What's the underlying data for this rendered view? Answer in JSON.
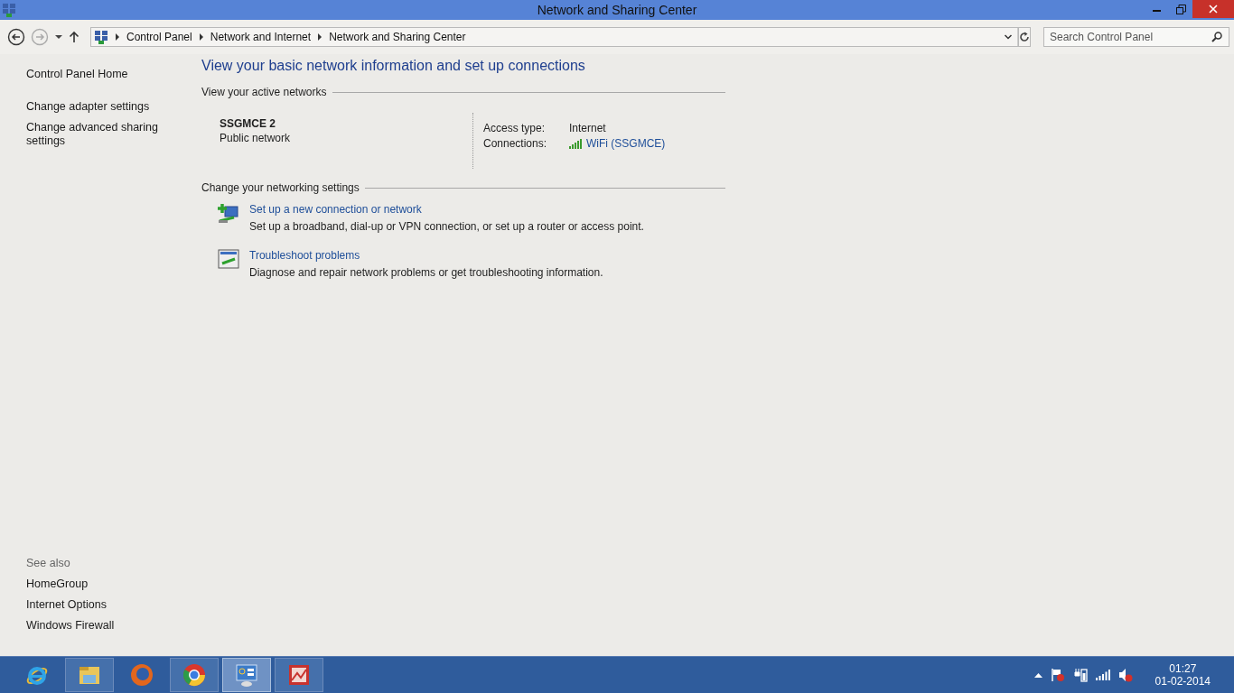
{
  "window": {
    "title": "Network and Sharing Center"
  },
  "address_bar": {
    "breadcrumb": [
      "Control Panel",
      "Network and Internet",
      "Network and Sharing Center"
    ],
    "search": {
      "placeholder": "Search Control Panel"
    }
  },
  "sidebar": {
    "links": [
      "Control Panel Home",
      "Change adapter settings",
      "Change advanced sharing settings"
    ],
    "see_also": {
      "heading": "See also",
      "links": [
        "HomeGroup",
        "Internet Options",
        "Windows Firewall"
      ]
    }
  },
  "main": {
    "heading": "View your basic network information and set up connections",
    "active_networks": {
      "heading": "View your active networks",
      "name": "SSGMCE  2",
      "type": "Public network",
      "access_type_label": "Access type:",
      "access_type": "Internet",
      "connections_label": "Connections:",
      "connection": "WiFi (SSGMCE)"
    },
    "settings": {
      "heading": "Change your networking settings",
      "tasks": [
        {
          "kind": "new-connection",
          "title": "Set up a new connection or network",
          "description": "Set up a broadband, dial-up or VPN connection, or set up a router or access point."
        },
        {
          "kind": "troubleshoot",
          "title": "Troubleshoot problems",
          "description": "Diagnose and repair network problems or get troubleshooting information."
        }
      ]
    }
  },
  "taskbar": {
    "apps": [
      {
        "kind": "ie",
        "running": false,
        "selected": false
      },
      {
        "kind": "explorer",
        "running": true,
        "selected": false
      },
      {
        "kind": "firefox",
        "running": false,
        "selected": false
      },
      {
        "kind": "chrome",
        "running": true,
        "selected": false
      },
      {
        "kind": "control-panel",
        "running": true,
        "selected": true
      },
      {
        "kind": "media",
        "running": true,
        "selected": false
      }
    ],
    "clock": {
      "time": "01:27",
      "date": "01-02-2014"
    }
  }
}
